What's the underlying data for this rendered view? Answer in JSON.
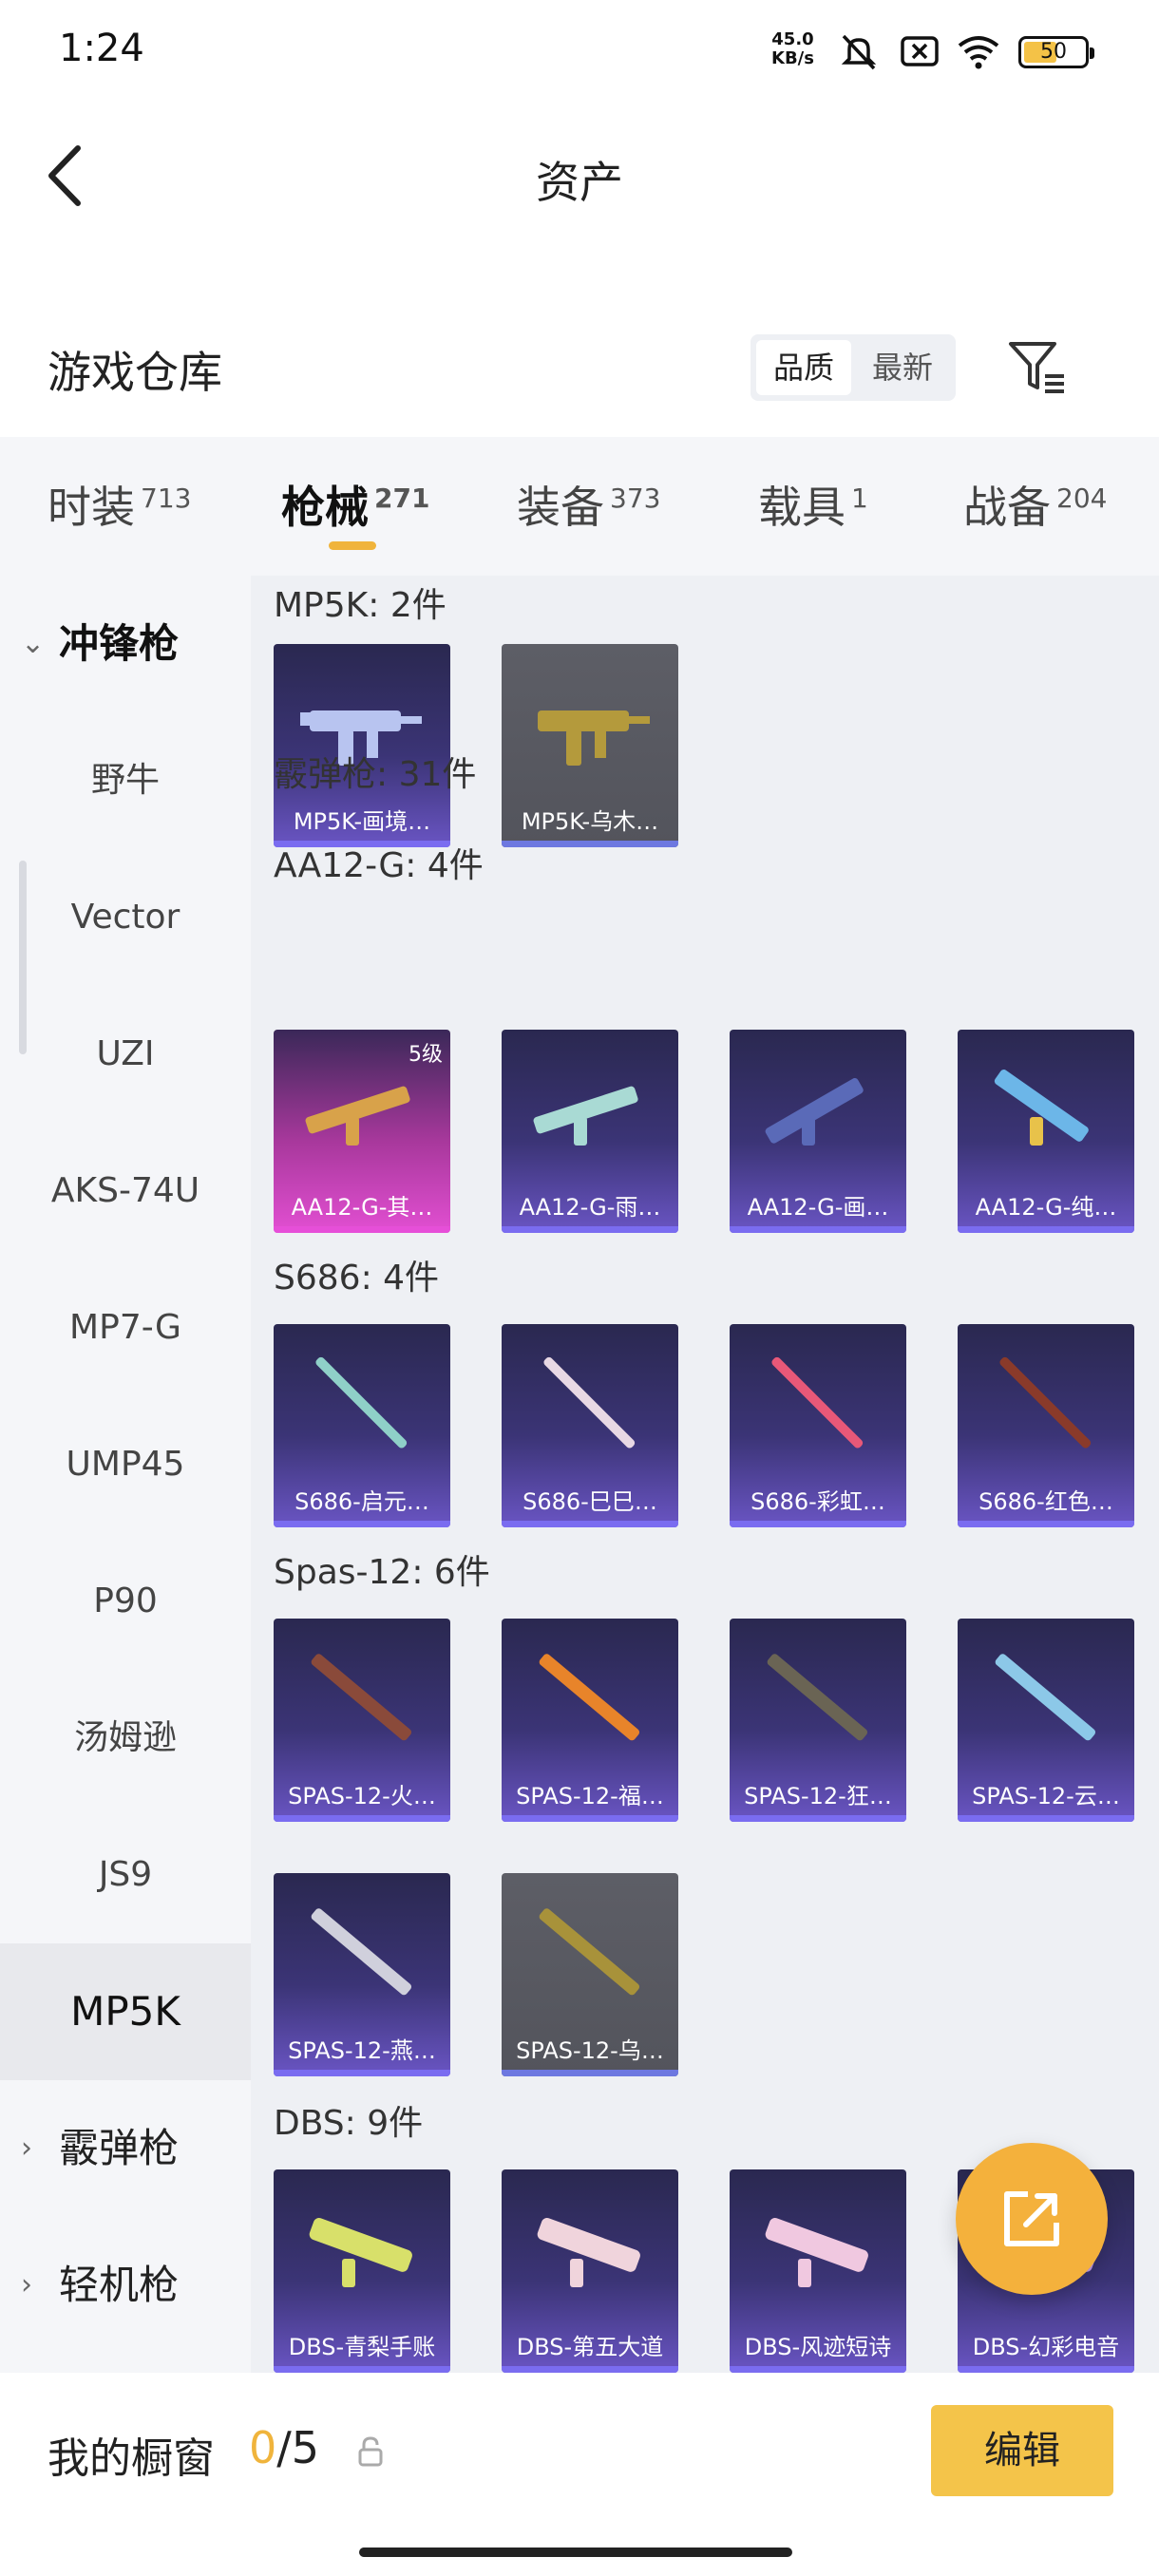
{
  "status_bar": {
    "time": "1:24",
    "net_speed": "45.0",
    "net_unit": "KB/s",
    "battery": "50"
  },
  "header": {
    "title": "资产"
  },
  "section": {
    "title": "游戏仓库",
    "sort_quality": "品质",
    "sort_newest": "最新"
  },
  "tabs": [
    {
      "label": "时装",
      "count": "713"
    },
    {
      "label": "枪械",
      "count": "271"
    },
    {
      "label": "装备",
      "count": "373"
    },
    {
      "label": "载具",
      "count": "1"
    },
    {
      "label": "战备",
      "count": "204"
    }
  ],
  "sidebar": {
    "category_open": "冲锋枪",
    "items": [
      "野牛",
      "Vector",
      "UZI",
      "AKS-74U",
      "MP7-G",
      "UMP45",
      "P90",
      "汤姆逊",
      "JS9",
      "MP5K"
    ],
    "category_2": "霰弹枪",
    "category_3": "轻机枪"
  },
  "content": {
    "groups": [
      {
        "title": "MP5K: 2件",
        "items": [
          "MP5K-画境…",
          "MP5K-乌木…"
        ]
      },
      {
        "title": "霰弹枪: 31件"
      },
      {
        "title": "AA12-G: 4件",
        "items": [
          "AA12-G-其…",
          "AA12-G-雨…",
          "AA12-G-画…",
          "AA12-G-纯…"
        ],
        "badge": "5级"
      },
      {
        "title": "S686: 4件",
        "items": [
          "S686-启元…",
          "S686-巳巳…",
          "S686-彩虹…",
          "S686-红色…"
        ]
      },
      {
        "title": "Spas-12: 6件",
        "items": [
          "SPAS-12-火…",
          "SPAS-12-福…",
          "SPAS-12-狂…",
          "SPAS-12-云…",
          "SPAS-12-燕…",
          "SPAS-12-乌…"
        ]
      },
      {
        "title": "DBS: 9件",
        "items": [
          "DBS-青梨手账",
          "DBS-第五大道",
          "DBS-风迹短诗",
          "DBS-幻彩电音"
        ]
      }
    ]
  },
  "bottom": {
    "showcase_label": "我的橱窗",
    "used": "0",
    "slash_total": "/5",
    "edit": "编辑"
  },
  "icons": {
    "back": "chevron-left-icon",
    "filter": "filter-icon",
    "fab": "share-external-icon",
    "lock": "lock-icon"
  },
  "colors": {
    "accent": "#f0b43c",
    "edit_button": "#f4c44a",
    "card_purple": "#3b3476",
    "card_gray": "#5d5e66",
    "card_pink": "#e24fd2"
  }
}
